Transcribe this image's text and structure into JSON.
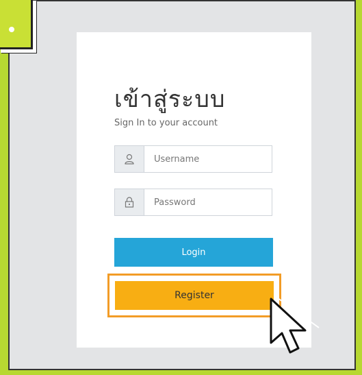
{
  "login": {
    "title": "เข้าสู่ระบบ",
    "subtitle": "Sign In to your account",
    "username": {
      "placeholder": "Username",
      "icon": "user-icon"
    },
    "password": {
      "placeholder": "Password",
      "icon": "lock-icon"
    },
    "login_label": "Login",
    "register_label": "Register"
  },
  "colors": {
    "frame_green": "#b7d832",
    "login_blue": "#25a5d8",
    "register_yellow": "#f8ae13",
    "highlight_orange": "#f29c26"
  }
}
